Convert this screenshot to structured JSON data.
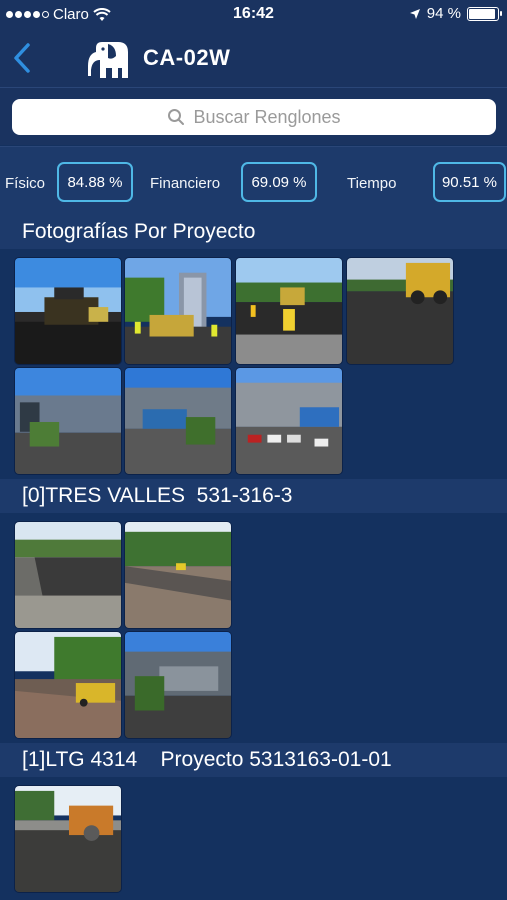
{
  "status_bar": {
    "carrier": "Claro",
    "time": "16:42",
    "battery": "94 %",
    "battery_level": 0.94
  },
  "nav": {
    "title": "CA-02W",
    "back_icon": "chevron-left-icon",
    "logo_icon": "elephant-logo-icon"
  },
  "search": {
    "placeholder": "Buscar Renglones"
  },
  "metrics": [
    {
      "label": "Físico",
      "value": "84.88 %"
    },
    {
      "label": "Financiero",
      "value": "69.09 %"
    },
    {
      "label": "Tiempo",
      "value": "90.51 %"
    }
  ],
  "sections": [
    {
      "title": "Fotografías Por Proyecto",
      "photo_count": 7
    },
    {
      "title": "[0]TRES VALLES  531-316-3",
      "photo_count": 4
    },
    {
      "title": "[1]LTG 4314    Proyecto 5313163-01-01",
      "photo_count": 1
    }
  ],
  "colors": {
    "background": "#14315f",
    "header_bar": "#1a3360",
    "metric_border": "#4fb8e6",
    "back_arrow": "#2f8fe0"
  }
}
